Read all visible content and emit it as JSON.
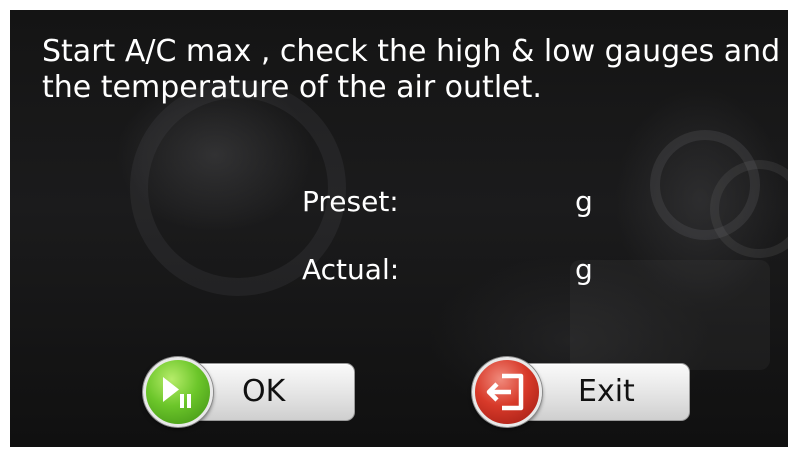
{
  "dialog": {
    "message": "Start A/C max , check the high & low gauges and the temperature of the air outlet."
  },
  "readings": {
    "preset_label": "Preset:",
    "preset_unit": "g",
    "actual_label": "Actual:",
    "actual_unit": "g"
  },
  "buttons": {
    "ok_label": "OK",
    "ok_icon": "play-pause-icon",
    "exit_label": "Exit",
    "exit_icon": "exit-door-icon"
  },
  "colors": {
    "ok_accent": "#6cc62a",
    "exit_accent": "#d83a2a",
    "text": "#ffffff"
  }
}
